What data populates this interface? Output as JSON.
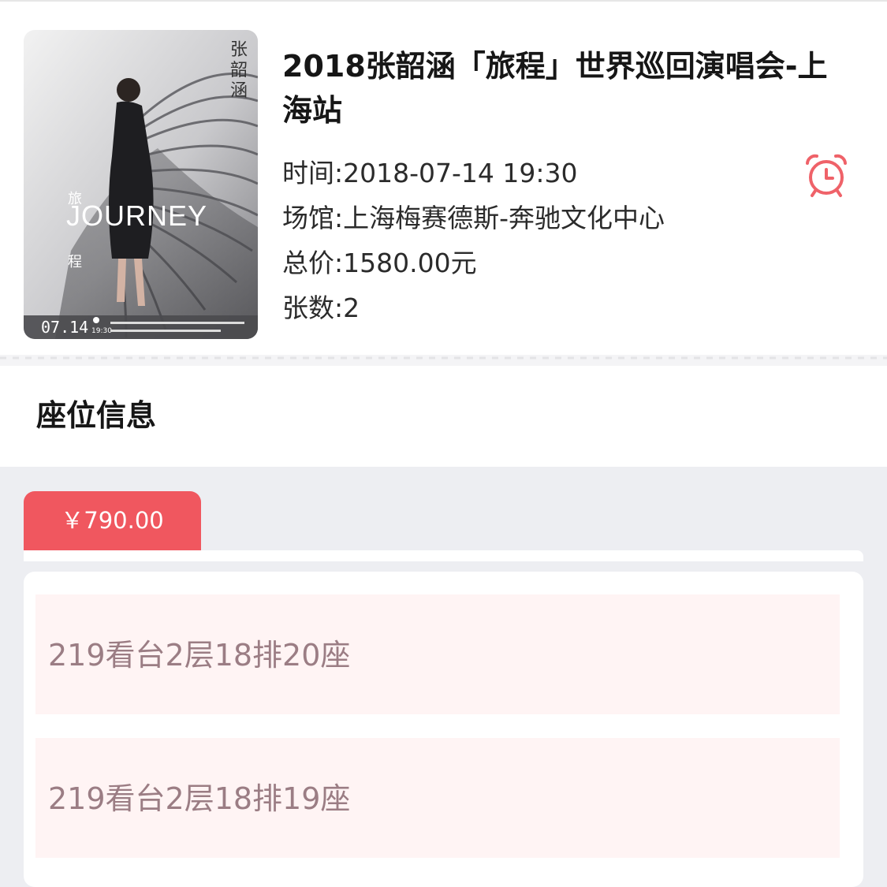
{
  "event": {
    "title": "2018张韶涵「旅程」世界巡回演唱会-上海站",
    "time": "时间:2018-07-14 19:30",
    "venue": "场馆:上海梅赛德斯-奔驰文化中心",
    "total": "总价:1580.00元",
    "count": "张数:2"
  },
  "poster": {
    "artist": "张韶涵",
    "journey": "JOURNEY",
    "cn1": "旅",
    "cn2": "程",
    "date": "07.14",
    "time": "19:30"
  },
  "seats_section": {
    "title": "座位信息",
    "price_tab": "￥790.00",
    "seats": [
      "219看台2层18排20座",
      "219看台2层18排19座"
    ]
  },
  "colors": {
    "accent": "#f0575f",
    "seat_bg": "#fff4f4",
    "seat_text": "#9b7d84",
    "page_bg": "#edeef2"
  },
  "icons": {
    "alarm": "alarm-clock-icon"
  }
}
